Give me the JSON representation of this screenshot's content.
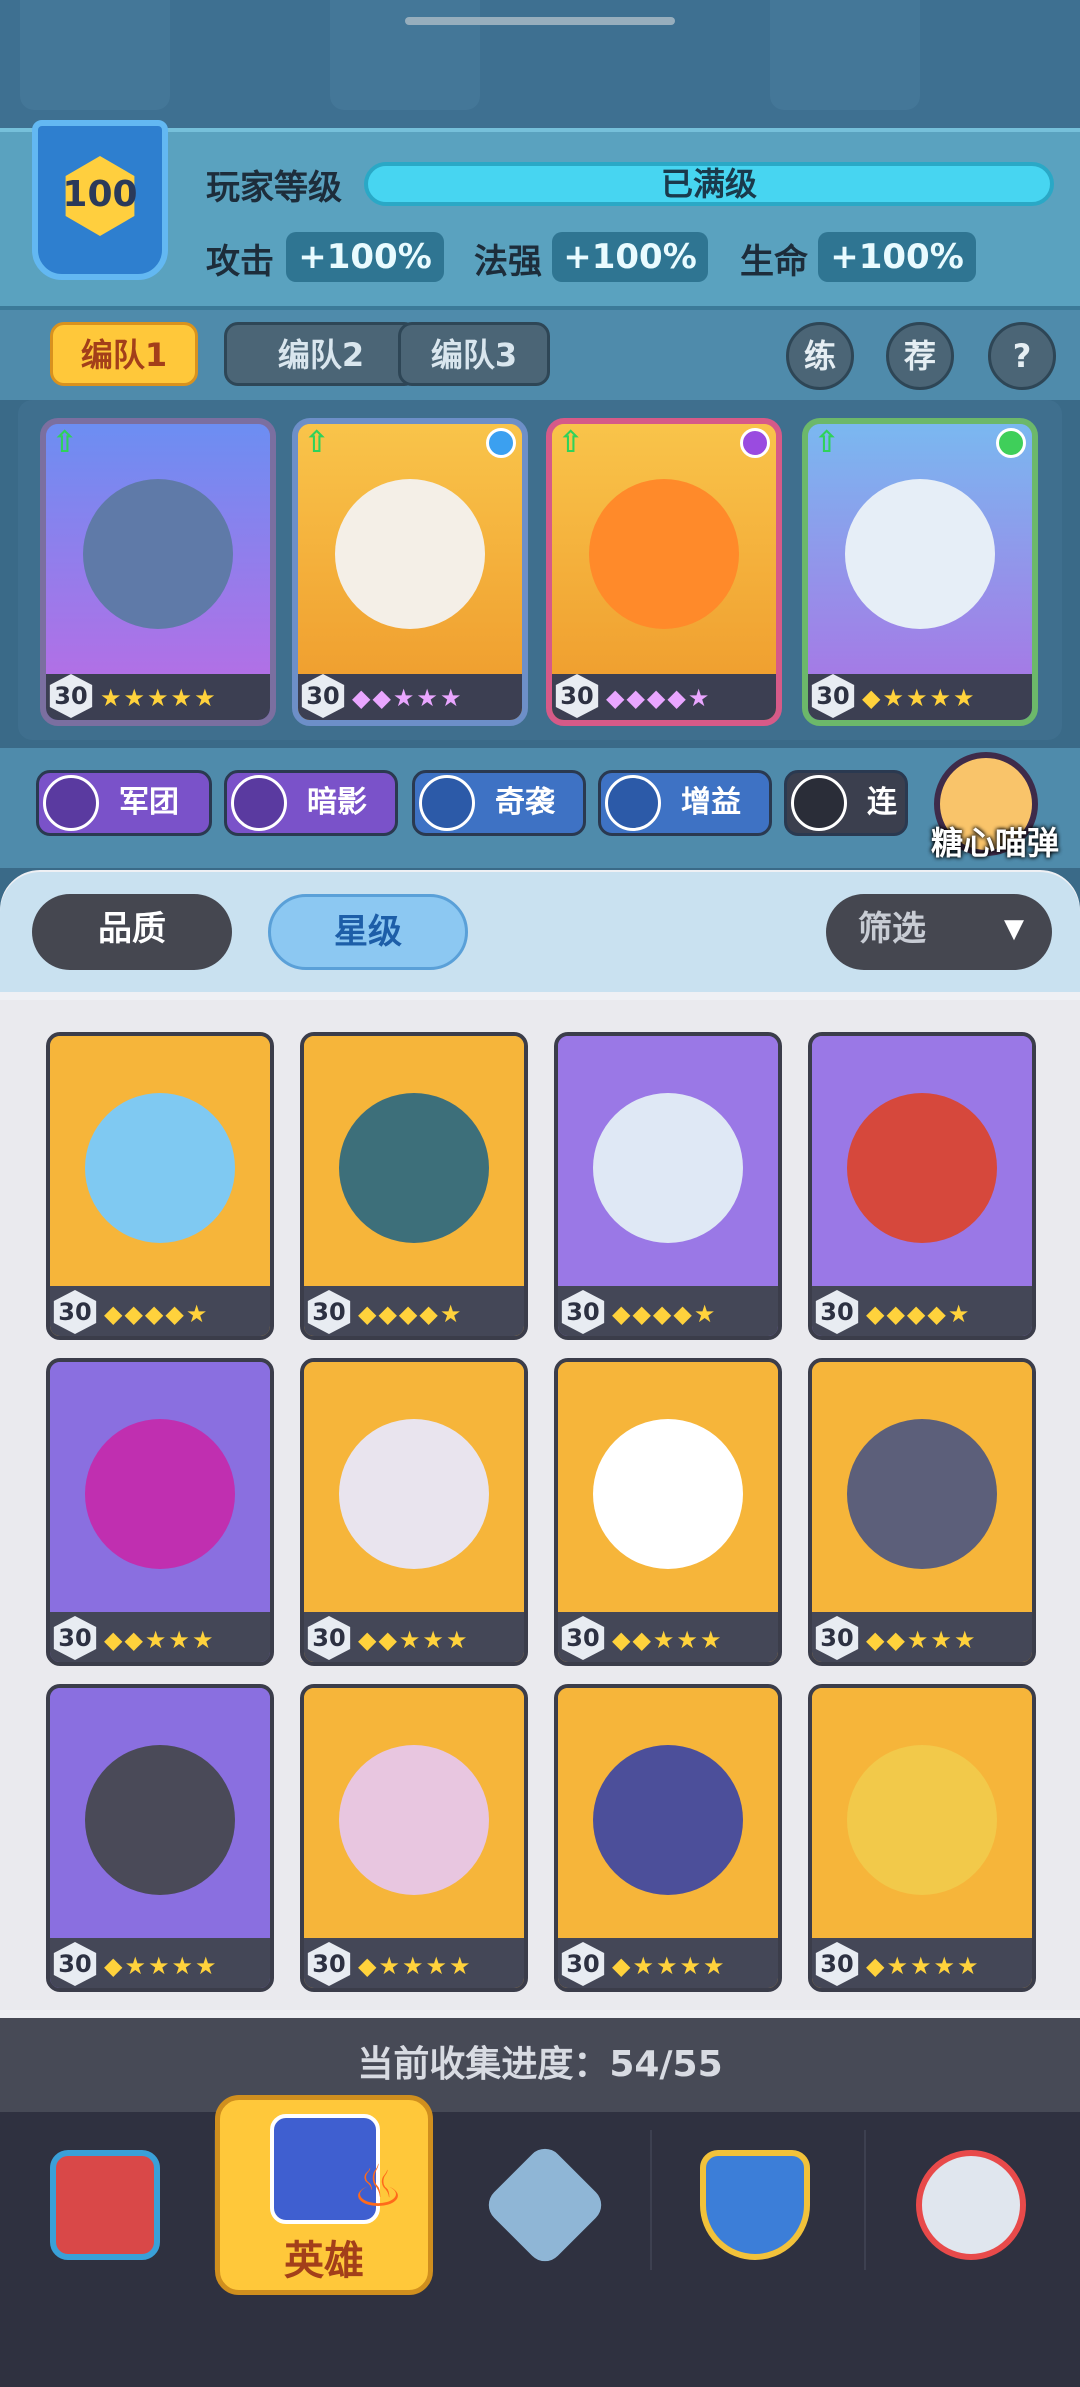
{
  "player": {
    "level": "100",
    "level_label": "玩家等级",
    "level_status": "已满级",
    "stats": [
      {
        "label": "攻击",
        "value": "+100%"
      },
      {
        "label": "法强",
        "value": "+100%"
      },
      {
        "label": "生命",
        "value": "+100%"
      }
    ]
  },
  "teams": [
    "编队1",
    "编队2",
    "编队3"
  ],
  "shortcuts": [
    "练",
    "荐",
    "?"
  ],
  "lineup": [
    {
      "level": "30",
      "stars": "★★★★★",
      "color": "#8a6fe0"
    },
    {
      "level": "30",
      "stars": "◆◆★★★",
      "color": "#f6b53a"
    },
    {
      "level": "30",
      "stars": "◆◆◆◆★",
      "color": "#f6b53a"
    },
    {
      "level": "30",
      "stars": "◆★★★★",
      "color": "#7a9be8"
    }
  ],
  "tags": [
    {
      "label": "军团",
      "color": "#7a52c9"
    },
    {
      "label": "暗影",
      "color": "#7a52c9"
    },
    {
      "label": "奇袭",
      "color": "#3e72c4"
    },
    {
      "label": "增益",
      "color": "#3e72c4"
    },
    {
      "label": "连",
      "color": "#3b3f4e"
    }
  ],
  "pet_name": "糖心喵弹",
  "sort": {
    "quality": "品质",
    "star": "星级",
    "filter": "筛选"
  },
  "heroes": [
    {
      "level": "30",
      "stars": "◆◆◆◆★",
      "bg": "#f6b53a",
      "body": "#7fc9f2"
    },
    {
      "level": "30",
      "stars": "◆◆◆◆★",
      "bg": "#f6b53a",
      "body": "#3d6f7a"
    },
    {
      "level": "30",
      "stars": "◆◆◆◆★",
      "bg": "#9a78e6",
      "body": "#dfe8f5"
    },
    {
      "level": "30",
      "stars": "◆◆◆◆★",
      "bg": "#9a78e6",
      "body": "#d6483c"
    },
    {
      "level": "30",
      "stars": "◆◆★★★",
      "bg": "#8a6fe0",
      "body": "#c02fb0"
    },
    {
      "level": "30",
      "stars": "◆◆★★★",
      "bg": "#f6b53a",
      "body": "#e9e4ee"
    },
    {
      "level": "30",
      "stars": "◆◆★★★",
      "bg": "#f6b53a",
      "body": "#ffffff"
    },
    {
      "level": "30",
      "stars": "◆◆★★★",
      "bg": "#f6b53a",
      "body": "#5c5f7a"
    },
    {
      "level": "30",
      "stars": "◆★★★★",
      "bg": "#8a6fe0",
      "body": "#4a4a58"
    },
    {
      "level": "30",
      "stars": "◆★★★★",
      "bg": "#f6b53a",
      "body": "#e8c6e0"
    },
    {
      "level": "30",
      "stars": "◆★★★★",
      "bg": "#f6b53a",
      "body": "#4c4f9a"
    },
    {
      "level": "30",
      "stars": "◆★★★★",
      "bg": "#f6b53a",
      "body": "#f2c94a"
    }
  ],
  "collection": "当前收集进度：54/55",
  "nav": {
    "hero_label": "英雄"
  }
}
